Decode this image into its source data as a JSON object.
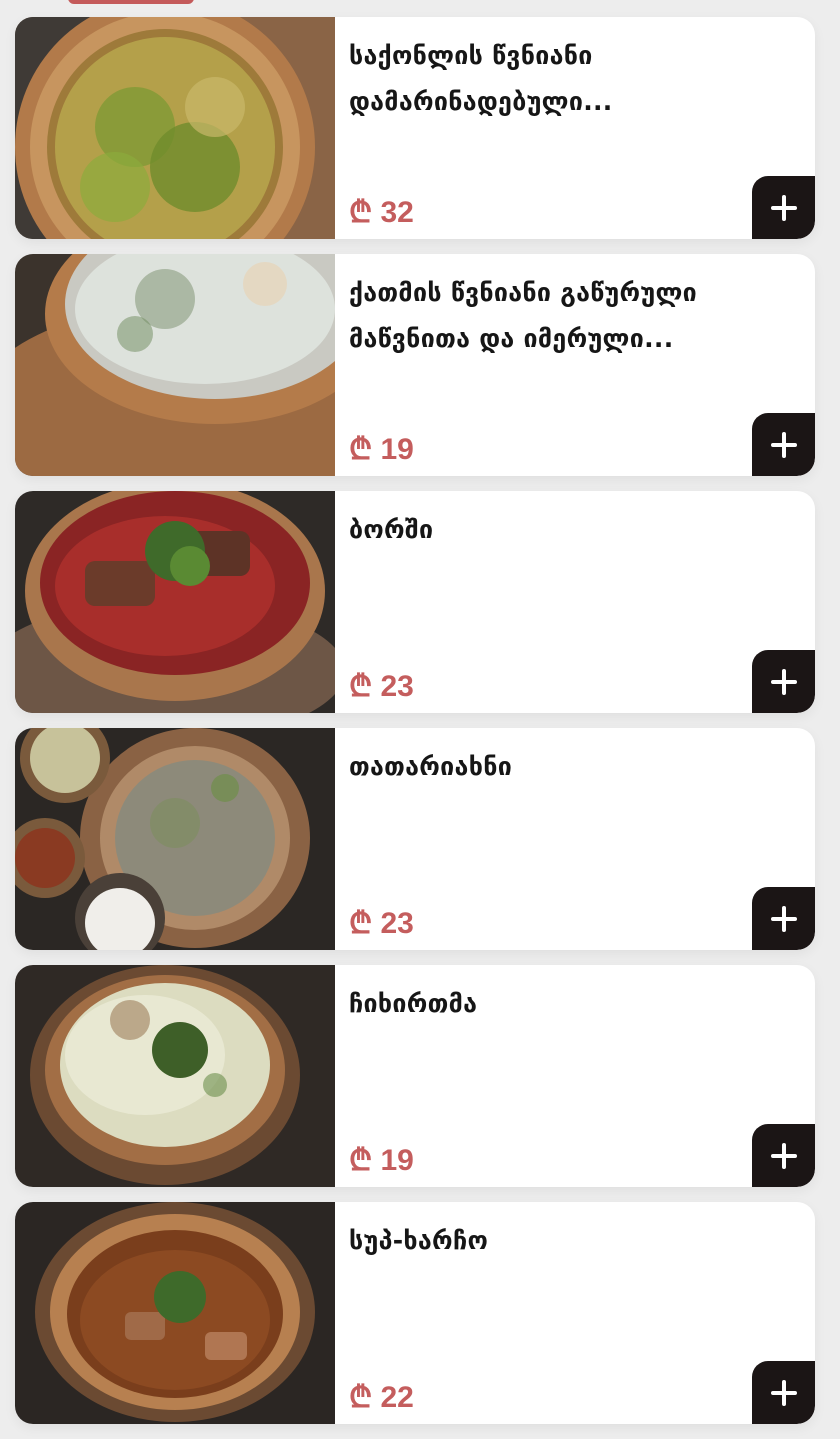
{
  "currency_symbol": "₾",
  "accent_color": "#c45d5d",
  "button_color": "#1b1515",
  "items": [
    {
      "title": "საქონლის წვნიანი დამარინადებული...",
      "price": "₾ 32",
      "image": "green-herb-soup"
    },
    {
      "title": "ქათმის წვნიანი გაწურული მაწვნითა და იმერული...",
      "price": "₾ 19",
      "image": "yogurt-chicken-soup"
    },
    {
      "title": "ბორში",
      "price": "₾ 23",
      "image": "borscht"
    },
    {
      "title": "თათარიახნი",
      "price": "₾ 23",
      "image": "tatariakhni-broth"
    },
    {
      "title": "ჩიხირთმა",
      "price": "₾ 19",
      "image": "chikhirtma"
    },
    {
      "title": "სუპ-ხარჩო",
      "price": "₾ 22",
      "image": "kharcho-soup"
    }
  ]
}
